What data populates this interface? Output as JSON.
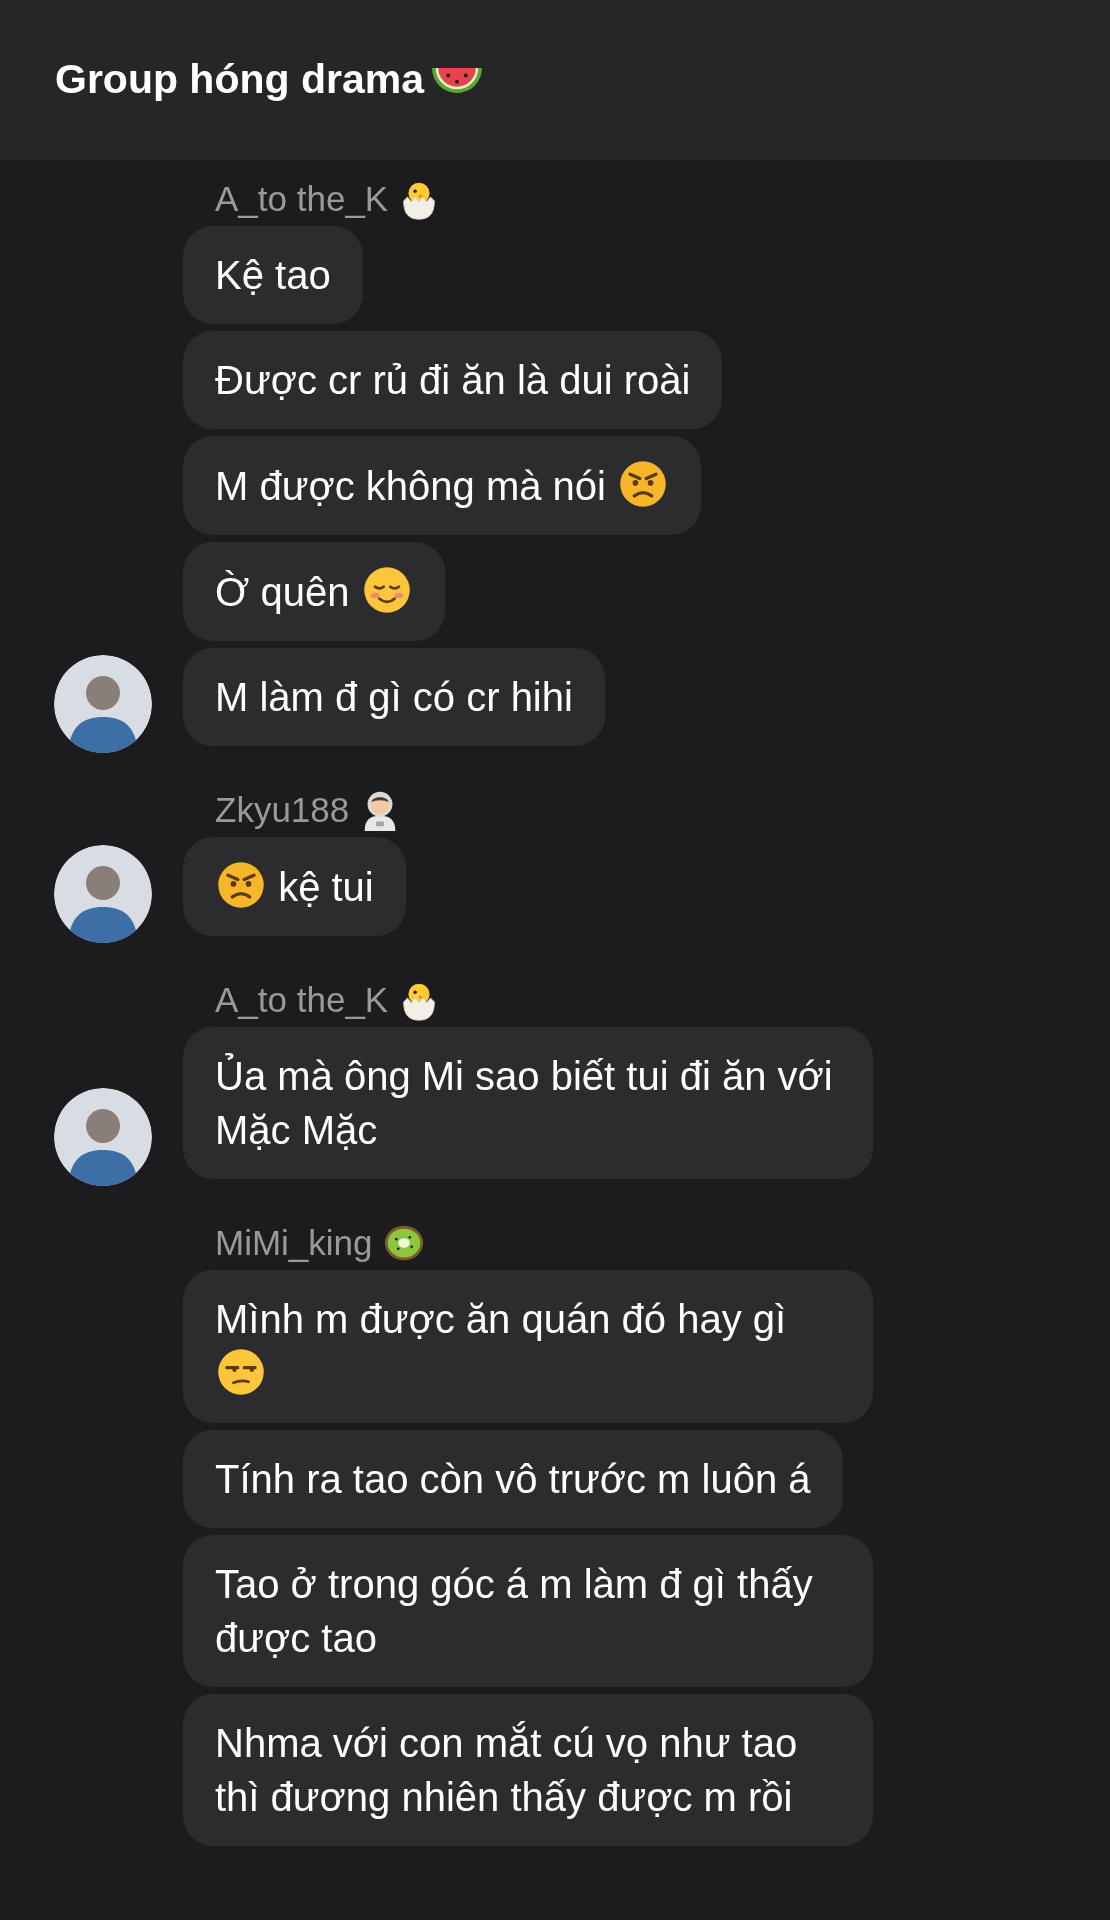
{
  "header": {
    "title": "Group hóng drama",
    "emoji": {
      "kind": "watermelon"
    }
  },
  "groups": [
    {
      "sender": "A_to the_K",
      "sender_emoji": {
        "kind": "chick"
      },
      "avatar": true,
      "messages": [
        {
          "parts": [
            {
              "kind": "text",
              "text": "Kệ tao"
            }
          ]
        },
        {
          "parts": [
            {
              "kind": "text",
              "text": "Được cr rủ đi ăn là dui roài"
            }
          ]
        },
        {
          "parts": [
            {
              "kind": "text",
              "text": "M được không mà nói"
            },
            {
              "kind": "angry"
            }
          ]
        },
        {
          "parts": [
            {
              "kind": "text",
              "text": "Ờ quên"
            },
            {
              "kind": "smile"
            }
          ]
        },
        {
          "parts": [
            {
              "kind": "text",
              "text": "M làm đ gì có cr hihi"
            }
          ]
        }
      ]
    },
    {
      "sender": "Zkyu188",
      "sender_emoji": {
        "kind": "astronaut"
      },
      "avatar": true,
      "messages": [
        {
          "parts": [
            {
              "kind": "angry"
            },
            {
              "kind": "text",
              "text": "kệ tui"
            }
          ]
        }
      ]
    },
    {
      "sender": "A_to the_K",
      "sender_emoji": {
        "kind": "chick"
      },
      "avatar": true,
      "messages": [
        {
          "parts": [
            {
              "kind": "text",
              "text": "Ủa mà ông Mi sao biết tui đi ăn với Mặc Mặc"
            }
          ]
        }
      ]
    },
    {
      "sender": "MiMi_king",
      "sender_emoji": {
        "kind": "kiwi"
      },
      "avatar": false,
      "messages": [
        {
          "parts": [
            {
              "kind": "text",
              "text": "Mình m được ăn quán đó hay gì"
            },
            {
              "kind": "unamused"
            }
          ]
        },
        {
          "parts": [
            {
              "kind": "text",
              "text": "Tính ra tao còn vô trước m luôn á"
            }
          ]
        },
        {
          "parts": [
            {
              "kind": "text",
              "text": "Tao ở trong góc á m làm đ gì thấy được tao"
            }
          ]
        },
        {
          "parts": [
            {
              "kind": "text",
              "text": "Nhma với con mắt cú vọ như tao thì đương nhiên thấy được m rồi"
            }
          ]
        }
      ]
    }
  ]
}
